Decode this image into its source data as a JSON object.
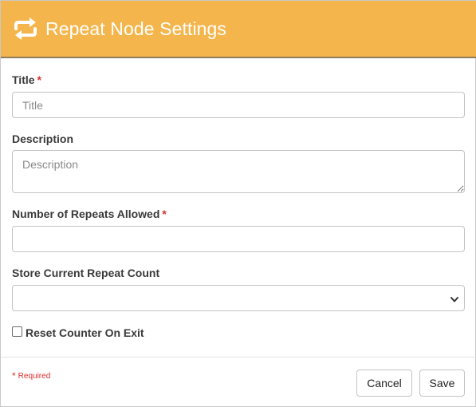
{
  "header": {
    "title": "Repeat Node Settings",
    "icon": "repeat-icon",
    "background": "#f4b64c"
  },
  "form": {
    "title_field": {
      "label": "Title",
      "required_mark": "*",
      "placeholder": "Title",
      "value": ""
    },
    "description_field": {
      "label": "Description",
      "placeholder": "Description",
      "value": ""
    },
    "repeats_field": {
      "label": "Number of Repeats Allowed",
      "required_mark": "*",
      "value": ""
    },
    "store_count_field": {
      "label": "Store Current Repeat Count",
      "selected": ""
    },
    "reset_counter": {
      "label": "Reset Counter On Exit",
      "checked": false
    }
  },
  "footer": {
    "required_note_mark": "*",
    "required_note_text": "Required",
    "cancel_label": "Cancel",
    "save_label": "Save"
  },
  "colors": {
    "accent": "#f4b64c",
    "required": "#d9302c"
  }
}
